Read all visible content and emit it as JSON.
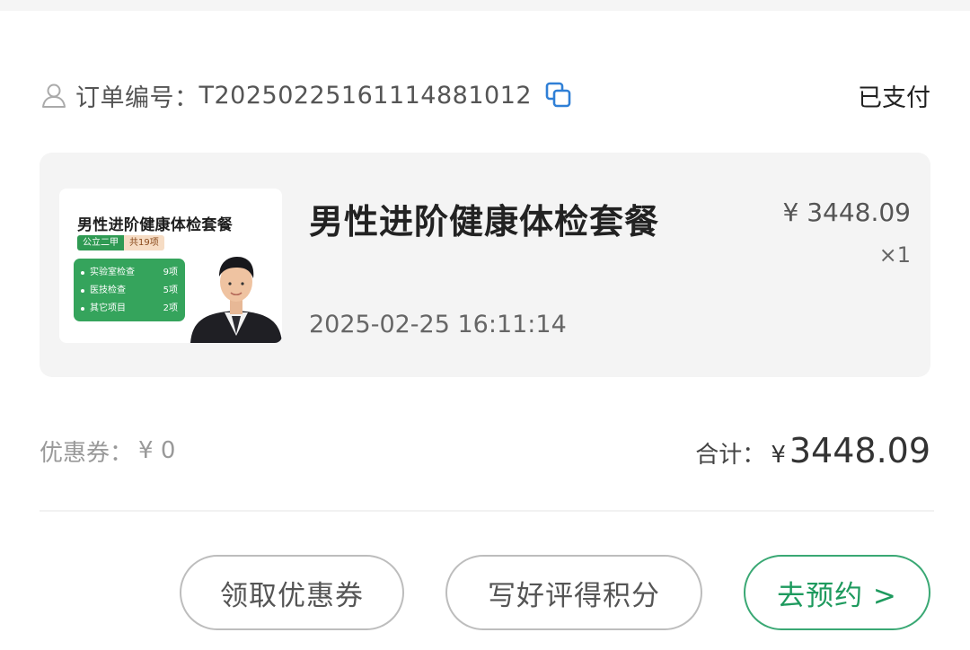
{
  "order": {
    "label": "订单编号：",
    "number": "T20250225161114881012",
    "status": "已支付"
  },
  "product": {
    "thumbnail": {
      "title": "男性进阶健康体检套餐",
      "tag_left": "公立二甲",
      "tag_right": "共19项",
      "items": [
        {
          "name": "实验室检查",
          "count": "9项"
        },
        {
          "name": "医技检查",
          "count": "5项"
        },
        {
          "name": "其它项目",
          "count": "2项"
        }
      ]
    },
    "title": "男性进阶健康体检套餐",
    "price": "¥ 3448.09",
    "quantity": "×1",
    "date": "2025-02-25 16:11:14"
  },
  "summary": {
    "coupon_label": "优惠券：",
    "coupon_value": "¥ 0",
    "total_label": "合计：",
    "total_yen": "¥",
    "total_amount": "3448.09"
  },
  "actions": {
    "get_coupon": "领取优惠券",
    "write_review": "写好评得积分",
    "book": "去预约 >"
  },
  "colors": {
    "accent_green": "#1e9a5e",
    "copy_icon_blue": "#2f7fd6",
    "card_bg": "#f4f4f4"
  }
}
